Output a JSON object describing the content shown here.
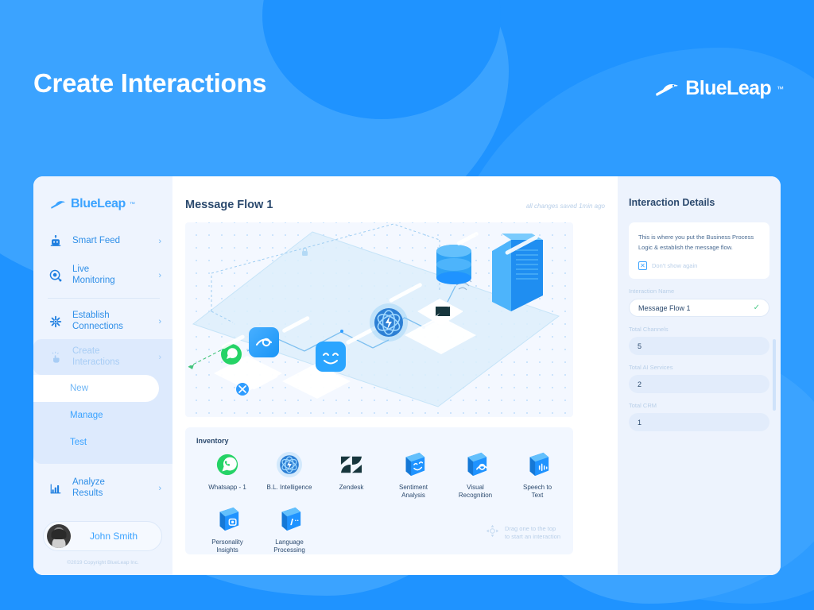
{
  "header": {
    "title": "Create Interactions",
    "brand": "BlueLeap",
    "brand_tm": "™",
    "logo_icon": "blueleap-dolphin-icon"
  },
  "sidebar": {
    "brand": "BlueLeap",
    "brand_tm": "™",
    "items": [
      {
        "label": "Smart Feed",
        "icon": "robot-icon",
        "chevron": "›"
      },
      {
        "label": "Live\nMonitoring",
        "label_line1": "Live",
        "label_line2": "Monitoring",
        "icon": "monitor-eye-icon",
        "chevron": "›"
      },
      {
        "label": "Establish\nConnections",
        "label_line1": "Establish",
        "label_line2": "Connections",
        "icon": "network-nodes-icon",
        "chevron": "›"
      },
      {
        "label": "Create\nInteractions",
        "label_line1": "Create",
        "label_line2": "Interactions",
        "icon": "hand-touch-icon",
        "chevron": "›",
        "active": true
      },
      {
        "label": "Analyze\nResults",
        "label_line1": "Analyze",
        "label_line2": "Results",
        "icon": "bar-chart-icon",
        "chevron": "›"
      }
    ],
    "submenu": [
      {
        "label": "New",
        "selected": true
      },
      {
        "label": "Manage",
        "selected": false
      },
      {
        "label": "Test",
        "selected": false
      }
    ],
    "user": {
      "name": "John Smith",
      "avatar": "user-avatar"
    },
    "copyright": "©2019 Copyright BlueLeap Inc."
  },
  "main": {
    "flow_title": "Message Flow 1",
    "saved_note": "all changes saved 1min ago",
    "canvas": {
      "nodes": [
        {
          "name": "whatsapp",
          "label": "Whatsapp"
        },
        {
          "name": "visual-recognition",
          "label": "Visual Recognition"
        },
        {
          "name": "sentiment-analysis",
          "label": "Sentiment Analysis"
        },
        {
          "name": "bl-intelligence",
          "label": "B.L. Intelligence"
        },
        {
          "name": "zendesk",
          "label": "Zendesk"
        },
        {
          "name": "database",
          "label": "Database"
        },
        {
          "name": "server",
          "label": "Server"
        }
      ]
    },
    "inventory": {
      "title": "Inventory",
      "items": [
        {
          "label": "Whatsapp - 1",
          "icon": "whatsapp-icon",
          "style": "whatsapp"
        },
        {
          "label": "B.L. Intelligence",
          "icon": "bl-intelligence-icon",
          "style": "atom"
        },
        {
          "label": "Zendesk",
          "icon": "zendesk-icon",
          "style": "zendesk"
        },
        {
          "label": "Sentiment Analysis",
          "label_line1": "Sentiment",
          "label_line2": "Analysis",
          "icon": "sentiment-analysis-icon",
          "style": "cube"
        },
        {
          "label": "Visual Recognition",
          "label_line1": "Visual",
          "label_line2": "Recognition",
          "icon": "visual-recognition-icon",
          "style": "cube"
        },
        {
          "label": "Speech to Text",
          "label_line1": "Speech to",
          "label_line2": "Text",
          "icon": "speech-to-text-icon",
          "style": "cube"
        },
        {
          "label": "Personality Insights",
          "label_line1": "Personality",
          "label_line2": "Insights",
          "icon": "personality-insights-icon",
          "style": "cube"
        },
        {
          "label": "Language Processing",
          "label_line1": "Language",
          "label_line2": "Processing",
          "icon": "language-processing-icon",
          "style": "cube"
        }
      ],
      "drag_hint_line1": "Drag one to the top",
      "drag_hint_line2": "to start an interaction",
      "drag_hint_icon": "move-arrows-icon"
    }
  },
  "details": {
    "title": "Interaction Details",
    "tip": {
      "text": "This is where you put the Business Process Logic & establish the message flow.",
      "checkbox_label": "Don't show again",
      "checkbox_mark": "✕",
      "checked": true
    },
    "fields": [
      {
        "label": "Interaction Name",
        "value": "Message Flow 1",
        "editable": true,
        "valid_mark": "✓"
      },
      {
        "label": "Total Channels",
        "value": "5",
        "editable": false
      },
      {
        "label": "Total AI Services",
        "value": "2",
        "editable": false
      },
      {
        "label": "Total CRM",
        "value": "1",
        "editable": false
      }
    ]
  },
  "colors": {
    "brand_blue": "#1f93ff",
    "accent_blue": "#3ba3ff",
    "panel_bg": "#edf3fd",
    "sidebar_bg": "#eef4fe",
    "text_dark": "#2c4a6e",
    "text_muted": "#b9cfe8",
    "whatsapp_green": "#25d366",
    "zendesk_dark": "#17363d",
    "valid_green": "#4ecb8a"
  }
}
